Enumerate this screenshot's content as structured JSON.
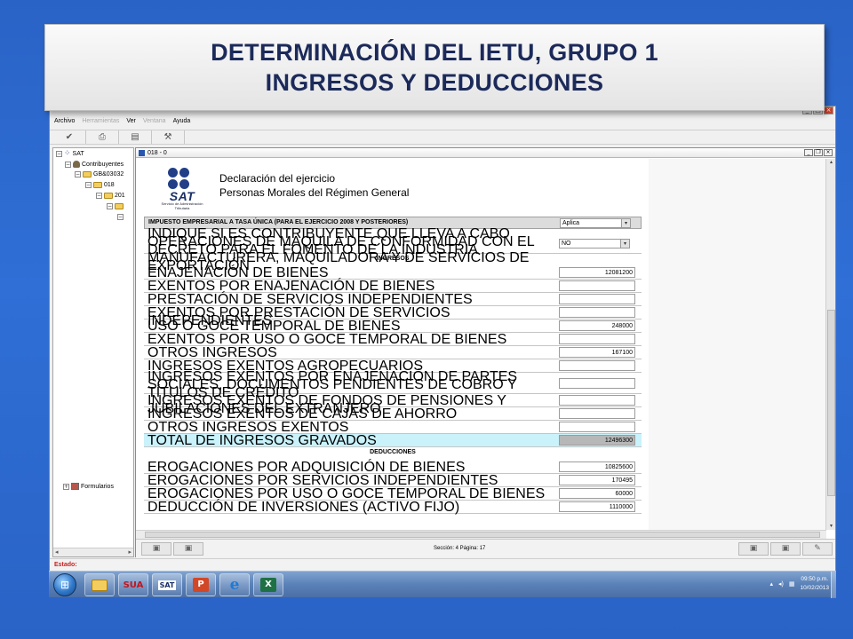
{
  "slide_title": {
    "line1": "DETERMINACIÓN DEL IETU, GRUPO 1",
    "line2": "INGRESOS Y DEDUCCIONES"
  },
  "menu": {
    "archivo": "Archivo",
    "herramientas": "Herramientas",
    "ver": "Ver",
    "ventana": "Ventana",
    "ayuda": "Ayuda"
  },
  "toolbar_icons": [
    "check-icon",
    "print-icon",
    "document-icon",
    "tools-icon"
  ],
  "tree": {
    "root": "SAT",
    "contribuyentes": "Contribuyentes",
    "rfc": "GB&03032",
    "form": "018",
    "year": "201",
    "formularios": "Formularios"
  },
  "doc_window": {
    "title": "018 - 0",
    "decl_title": "Declaración del ejercicio",
    "decl_subtitle": "Personas Morales del Régimen General",
    "sat_word": "SAT",
    "sat_sub": "Servicio de Administración Tributaria"
  },
  "form": {
    "header_label": "IMPUESTO EMPRESARIAL A TASA ÚNICA (PARA EL EJERCICIO 2008 Y POSTERIORES)",
    "header_value": "Aplica",
    "maquila_label": "INDIQUE SI ES CONTRIBUYENTE QUE LLEVA A CABO OPERACIONES DE MAQUILA DE CONFORMIDAD CON EL DECRETO PARA EL FOMENTO DE LA INDUSTRIA MANUFACTURERA, MAQUILADORA Y DE SERVICIOS DE EXPORTACIÓN",
    "maquila_value": "NO",
    "ingresos_title": "INGRESOS",
    "ingresos": [
      {
        "label": "ENAJENACIÓN DE BIENES",
        "value": "12081200"
      },
      {
        "label": "EXENTOS POR ENAJENACIÓN DE BIENES",
        "value": ""
      },
      {
        "label": "PRESTACIÓN DE SERVICIOS INDEPENDIENTES",
        "value": ""
      },
      {
        "label": "EXENTOS POR PRESTACIÓN DE SERVICIOS INDEPENDIENTES",
        "value": ""
      },
      {
        "label": "USO O GOCE TEMPORAL DE BIENES",
        "value": "248000"
      },
      {
        "label": "EXENTOS POR USO O GOCE TEMPORAL DE BIENES",
        "value": ""
      },
      {
        "label": "OTROS INGRESOS",
        "value": "167100"
      },
      {
        "label": "INGRESOS EXENTOS AGROPECUARIOS",
        "value": ""
      },
      {
        "label": "INGRESOS EXENTOS POR ENAJENACIÓN DE PARTES SOCIALES, DOCUMENTOS PENDIENTES DE COBRO Y TÍTULOS DE CRÉDITO",
        "value": ""
      },
      {
        "label": "INGRESOS EXENTOS DE FONDOS DE PENSIONES Y JUBILACIONES DEL EXTRANJERO",
        "value": ""
      },
      {
        "label": "INGRESOS EXENTOS DE CAJAS DE AHORRO",
        "value": ""
      },
      {
        "label": "OTROS INGRESOS EXENTOS",
        "value": ""
      },
      {
        "label": "TOTAL DE INGRESOS GRAVADOS",
        "value": "12496300"
      }
    ],
    "deducciones_title": "DEDUCCIONES",
    "deducciones": [
      {
        "label": "EROGACIONES POR ADQUISICIÓN DE BIENES",
        "value": "10825600"
      },
      {
        "label": "EROGACIONES POR SERVICIOS INDEPENDIENTES",
        "value": "170495"
      },
      {
        "label": "EROGACIONES POR USO O GOCE TEMPORAL DE BIENES",
        "value": "60000"
      },
      {
        "label": "DEDUCCIÓN DE INVERSIONES (ACTIVO FIJO)",
        "value": "1110000"
      }
    ]
  },
  "footer": {
    "section_info": "Sección: 4  Página: 17"
  },
  "status": {
    "label": "Estado:"
  },
  "taskbar": {
    "items": [
      "start-button",
      "explorer",
      "sua",
      "sat",
      "powerpoint",
      "internet-explorer",
      "excel"
    ],
    "sua_label": "SUA",
    "sat_label": "SAT",
    "time": "09:50 p.m.",
    "date": "10/02/2013"
  },
  "colors": {
    "background": "#2f6fd6",
    "title_text": "#1c2a5a",
    "total_row": "#c9f2fb",
    "status_text": "#c51e1e"
  }
}
